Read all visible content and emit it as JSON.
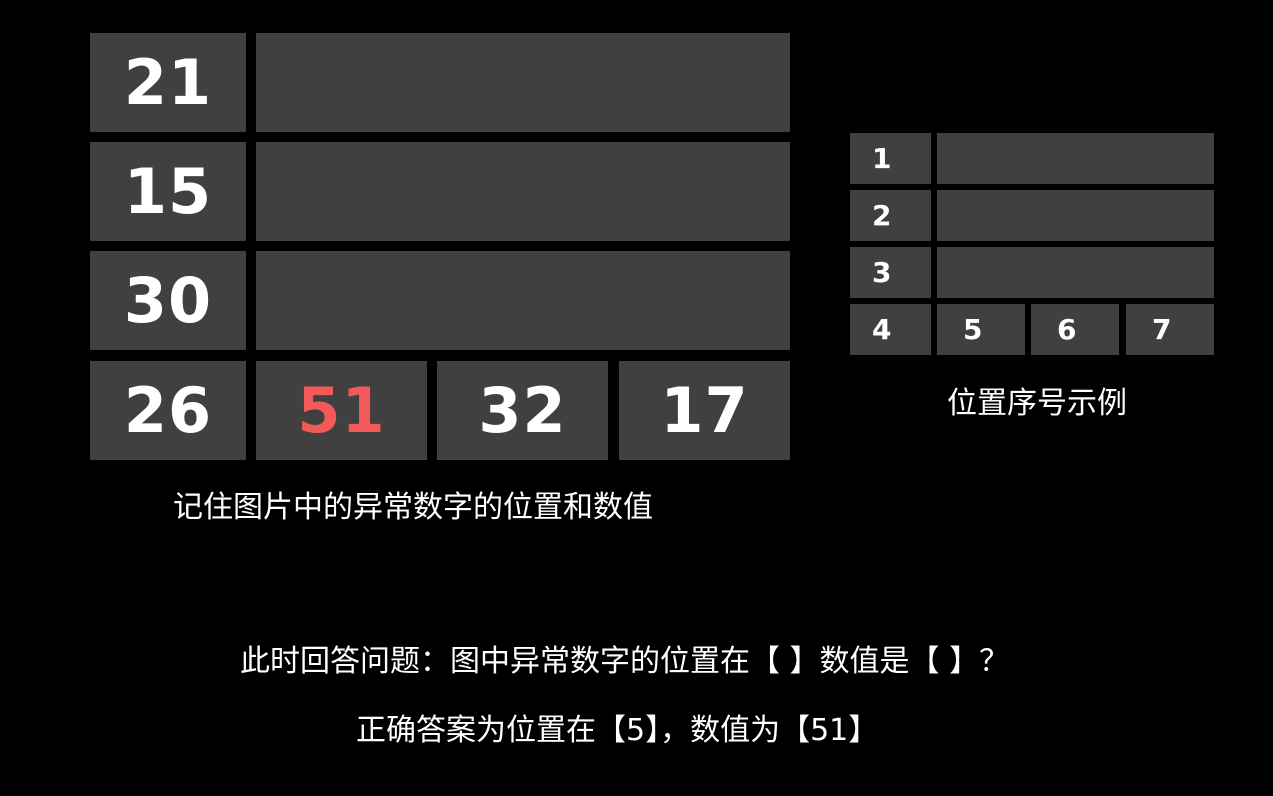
{
  "main_grid": {
    "rows": [
      {
        "first": "21"
      },
      {
        "first": "15"
      },
      {
        "first": "30"
      }
    ],
    "bottom_row": [
      "26",
      "51",
      "32",
      "17"
    ],
    "highlight_color": "#f25a5a",
    "caption": "记住图片中的异常数字的位置和数值"
  },
  "example_grid": {
    "labels": [
      "1",
      "2",
      "3",
      "4",
      "5",
      "6",
      "7"
    ],
    "caption": "位置序号示例"
  },
  "question": "此时回答问题：图中异常数字的位置在【 】数值是【 】？",
  "answer": "正确答案为位置在【5】，数值为【51】",
  "colors": {
    "background": "#000000",
    "cell": "#404040",
    "text": "#ffffff"
  }
}
